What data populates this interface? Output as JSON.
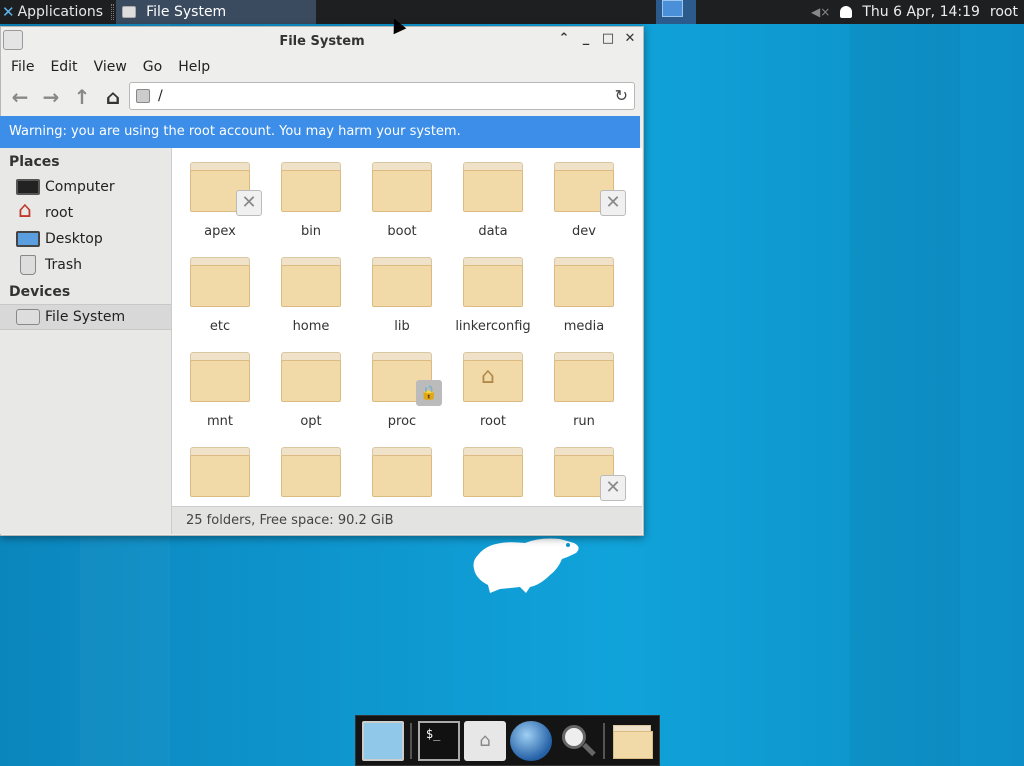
{
  "top_panel": {
    "applications_label": "Applications",
    "task_label": "File System",
    "clock": "Thu  6 Apr, 14:19",
    "user": "root"
  },
  "window": {
    "title": "File System",
    "menu": [
      "File",
      "Edit",
      "View",
      "Go",
      "Help"
    ],
    "path": "/",
    "warning": "Warning: you are using the root account. You may harm your system.",
    "sidebar": {
      "places_header": "Places",
      "places": [
        {
          "label": "Computer",
          "icon": "computer-icon"
        },
        {
          "label": "root",
          "icon": "home-icon"
        },
        {
          "label": "Desktop",
          "icon": "desktop-icon"
        },
        {
          "label": "Trash",
          "icon": "trash-icon"
        }
      ],
      "devices_header": "Devices",
      "devices": [
        {
          "label": "File System",
          "icon": "drive-icon",
          "selected": true
        }
      ]
    },
    "folders": [
      {
        "name": "apex",
        "emblem": "unreadable"
      },
      {
        "name": "bin",
        "emblem": ""
      },
      {
        "name": "boot",
        "emblem": ""
      },
      {
        "name": "data",
        "emblem": ""
      },
      {
        "name": "dev",
        "emblem": "unreadable"
      },
      {
        "name": "etc",
        "emblem": ""
      },
      {
        "name": "home",
        "emblem": ""
      },
      {
        "name": "lib",
        "emblem": ""
      },
      {
        "name": "linkerconfig",
        "emblem": ""
      },
      {
        "name": "media",
        "emblem": ""
      },
      {
        "name": "mnt",
        "emblem": ""
      },
      {
        "name": "opt",
        "emblem": ""
      },
      {
        "name": "proc",
        "emblem": "lock"
      },
      {
        "name": "root",
        "emblem": "home"
      },
      {
        "name": "run",
        "emblem": ""
      },
      {
        "name": "",
        "emblem": ""
      },
      {
        "name": "",
        "emblem": ""
      },
      {
        "name": "",
        "emblem": ""
      },
      {
        "name": "",
        "emblem": ""
      },
      {
        "name": "",
        "emblem": "unreadable"
      }
    ],
    "status": "25 folders, Free space: 90.2 GiB"
  },
  "dock": {
    "items": [
      "show-desktop-icon",
      "terminal-icon",
      "home-folder-icon",
      "web-browser-icon",
      "search-icon",
      "file-manager-icon"
    ]
  },
  "colors": {
    "desktop": "#0e97cf",
    "warning_bar": "#3c8ee8",
    "folder": "#f2d9a8"
  }
}
